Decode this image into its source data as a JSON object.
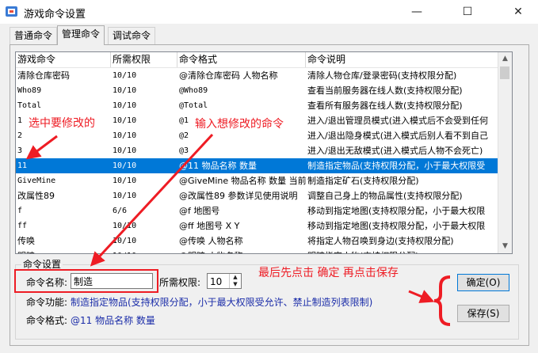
{
  "window": {
    "title": "游戏命令设置",
    "minimize_glyph": "—",
    "maximize_glyph": "☐",
    "close_glyph": "✕"
  },
  "tabs": [
    {
      "label": "普通命令"
    },
    {
      "label": "管理命令"
    },
    {
      "label": "调试命令"
    }
  ],
  "table": {
    "headers": [
      "游戏命令",
      "所需权限",
      "命令格式",
      "命令说明"
    ],
    "rows": [
      [
        "清除仓库密码",
        "10/10",
        "@清除仓库密码 人物名称",
        "清除人物仓库/登录密码(支持权限分配)"
      ],
      [
        "Who89",
        "10/10",
        "@Who89",
        "查看当前服务器在线人数(支持权限分配)"
      ],
      [
        "Total",
        "10/10",
        "@Total",
        "查看所有服务器在线人数(支持权限分配)"
      ],
      [
        "1",
        "10/10",
        "@1",
        "进入/退出管理员模式(进入模式后不会受到任何"
      ],
      [
        "2",
        "10/10",
        "@2",
        "进入/退出隐身模式(进入模式后别人看不到自己"
      ],
      [
        "3",
        "10/10",
        "@3",
        "进入/退出无敌模式(进入模式后人物不会死亡)"
      ],
      [
        "11",
        "10/10",
        "@11 物品名称 数量",
        "制造指定物品(支持权限分配，小于最大权限受"
      ],
      [
        "GiveMine",
        "10/10",
        "@GiveMine 物品名称 数量 当前",
        "制造指定矿石(支持权限分配)"
      ],
      [
        "改属性89",
        "10/10",
        "@改属性89 参数详见使用说明",
        "调整自己身上的物品属性(支持权限分配)"
      ],
      [
        "f",
        "6/6",
        "@f 地图号",
        "移动到指定地图(支持权限分配，小于最大权限"
      ],
      [
        "ff",
        "10/10",
        "@ff 地图号 X Y",
        "移动到指定地图(支持权限分配，小于最大权限"
      ],
      [
        "传唤",
        "10/10",
        "@传唤 人物名称",
        "将指定人物召唤到身边(支持权限分配)"
      ],
      [
        "明暗",
        "10/10",
        "@明暗 人物名称",
        "明暗指定人物(支持权限分配)"
      ]
    ],
    "selected_index": 6,
    "scroll_up": "▲",
    "scroll_down": "▼"
  },
  "settings": {
    "group_title": "命令设置",
    "name_label": "命令名称:",
    "name_value": "制造",
    "perm_label": "所需权限:",
    "perm_value": "10",
    "func_label": "命令功能:",
    "func_value": "制造指定物品(支持权限分配，小于最大权限受允许、禁止制造列表限制)",
    "format_label": "命令格式:",
    "format_value": "@11 物品名称 数量",
    "confirm_button": "确定(O)",
    "save_button": "保存(S)",
    "spin_up": "▲",
    "spin_down": "▼"
  },
  "annotations": {
    "select": "选中要修改的",
    "input": "输入想修改的命令",
    "final": "最后先点击 确定 再点击保存",
    "color": "#ee1c24"
  },
  "colors": {
    "selection": "#0078d7",
    "blue_text": "#1a2ca8"
  }
}
